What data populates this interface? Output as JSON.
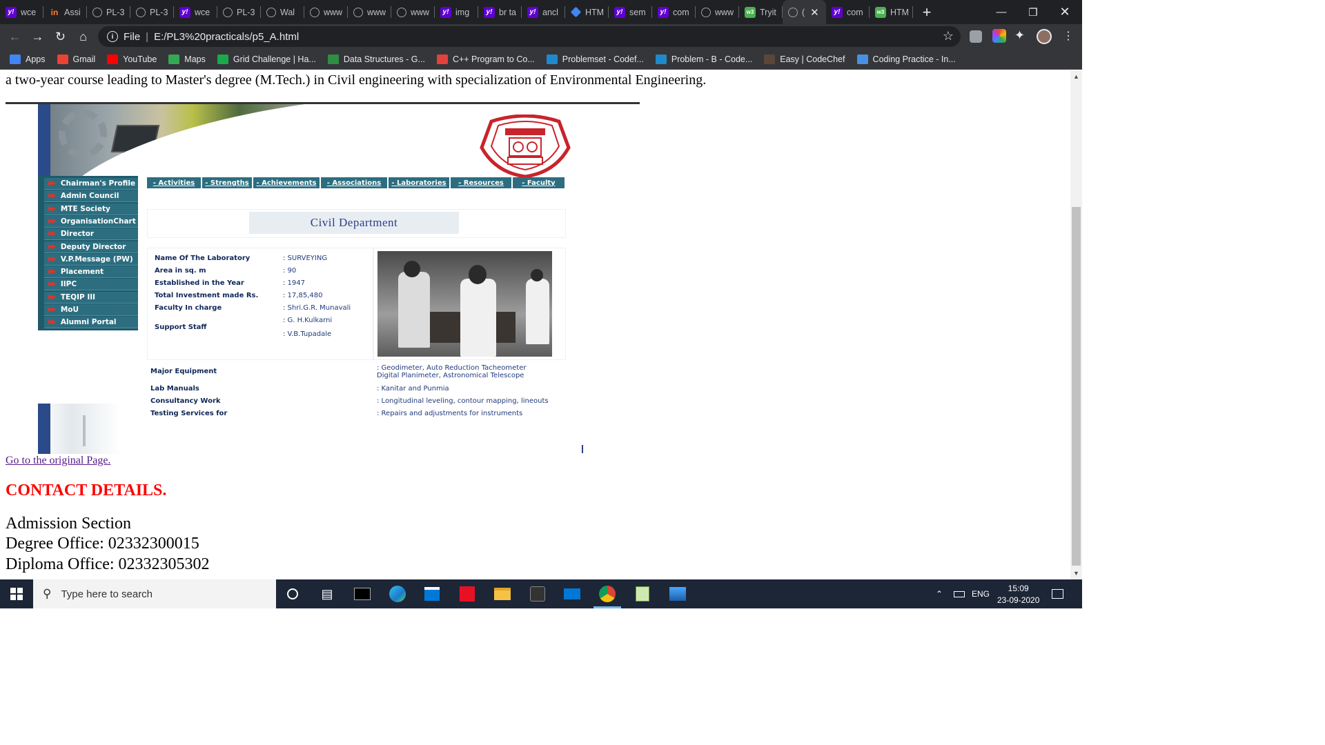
{
  "browser": {
    "tabs": [
      {
        "title": "wce",
        "icon": "yahoo-icon"
      },
      {
        "title": "Assi",
        "icon": "linkedin-icon"
      },
      {
        "title": "PL-3",
        "icon": "globe-icon"
      },
      {
        "title": "PL-3",
        "icon": "globe-icon"
      },
      {
        "title": "wce",
        "icon": "yahoo-icon"
      },
      {
        "title": "PL-3",
        "icon": "globe-icon"
      },
      {
        "title": "Wal",
        "icon": "globe-icon"
      },
      {
        "title": "www",
        "icon": "globe-icon"
      },
      {
        "title": "www",
        "icon": "globe-icon"
      },
      {
        "title": "www",
        "icon": "globe-icon"
      },
      {
        "title": "img",
        "icon": "yahoo-icon"
      },
      {
        "title": "br ta",
        "icon": "yahoo-icon"
      },
      {
        "title": "ancl",
        "icon": "yahoo-icon"
      },
      {
        "title": "HTM",
        "icon": "diamond-icon"
      },
      {
        "title": "sem",
        "icon": "yahoo-icon"
      },
      {
        "title": "com",
        "icon": "yahoo-icon"
      },
      {
        "title": "www",
        "icon": "globe-icon"
      },
      {
        "title": "Tryit",
        "icon": "w3-icon"
      },
      {
        "title": "(",
        "icon": "globe-icon",
        "active": true
      },
      {
        "title": "com",
        "icon": "yahoo-icon"
      },
      {
        "title": "HTM",
        "icon": "w3-icon"
      }
    ],
    "address": {
      "scheme_label": "File",
      "url": "E:/PL3%20practicals/p5_A.html"
    },
    "bookmarks": [
      {
        "label": "Apps",
        "icon": "apps-grid-icon"
      },
      {
        "label": "Gmail",
        "icon": "gmail-icon"
      },
      {
        "label": "YouTube",
        "icon": "youtube-icon"
      },
      {
        "label": "Maps",
        "icon": "maps-icon"
      },
      {
        "label": "Grid Challenge | Ha...",
        "icon": "hackerrank-icon"
      },
      {
        "label": "Data Structures - G...",
        "icon": "gfg-icon"
      },
      {
        "label": "C++ Program to Co...",
        "icon": "tutorialspoint-icon"
      },
      {
        "label": "Problemset - Codef...",
        "icon": "codeforces-icon"
      },
      {
        "label": "Problem - B - Code...",
        "icon": "codeforces-icon"
      },
      {
        "label": "Easy | CodeChef",
        "icon": "codechef-icon"
      },
      {
        "label": "Coding Practice - In...",
        "icon": "interviewbit-icon"
      }
    ]
  },
  "page": {
    "intro_text": "a two-year course leading to Master's degree (M.Tech.) in Civil engineering with specialization of Environmental Engineering.",
    "sidebar": [
      "Chairman's Profile",
      "Admin Council",
      "MTE Society",
      "OrganisationChart",
      "Director",
      "Deputy Director",
      "V.P.Message (PW)",
      "Placement",
      "IIPC",
      "TEQIP III",
      "MoU",
      "Alumni Portal"
    ],
    "topnav": [
      "- Activities",
      "- Strengths",
      "- Achievements",
      "- Associations",
      "- Laboratories",
      "- Resources",
      "- Faculty"
    ],
    "department_title": "Civil Department",
    "lab": {
      "name_label": "Name Of The Laboratory",
      "name_value": ": SURVEYING",
      "area_label": "Area in sq. m",
      "area_value": ": 90",
      "year_label": "Established in the Year",
      "year_value": ": 1947",
      "investment_label": "Total Investment made Rs.",
      "investment_value": ": 17,85,480",
      "faculty_label": "Faculty In charge",
      "faculty_value": ": Shri.G.R. Munavali",
      "staff_label": "Support Staff",
      "staff_value_1": ": G. H.Kulkarni",
      "staff_value_2": ": V.B.Tupadale"
    },
    "equipment": {
      "major_label": "Major Equipment",
      "major_value_1": ": Geodimeter, Auto Reduction Tacheometer",
      "major_value_2": "Digital Planimeter, Astronomical Telescope",
      "manuals_label": "Lab Manuals",
      "manuals_value": ": Kanitar and Punmia",
      "consultancy_label": "Consultancy Work",
      "consultancy_value": ": Longitudinal leveling, contour mapping, lineouts",
      "testing_label": "Testing Services for",
      "testing_value": ": Repairs and adjustments for instruments"
    },
    "original_link": "Go to the original Page.",
    "contact_heading": "CONTACT DETAILS.",
    "contact_lines": [
      "Admission Section",
      "Degree Office: 02332300015",
      "Diploma Office: 02332305302"
    ]
  },
  "taskbar": {
    "search_placeholder": "Type here to search",
    "language": "ENG",
    "time": "15:09",
    "date": "23-09-2020"
  },
  "colors": {
    "chrome_dark": "#202124",
    "chrome_toolbar": "#35363a",
    "sidebar_teal": "#2c6e80",
    "lab_text": "#0f2757",
    "contact_red": "#ff0000",
    "link_visited": "#551a8b",
    "taskbar": "#1c2637"
  }
}
